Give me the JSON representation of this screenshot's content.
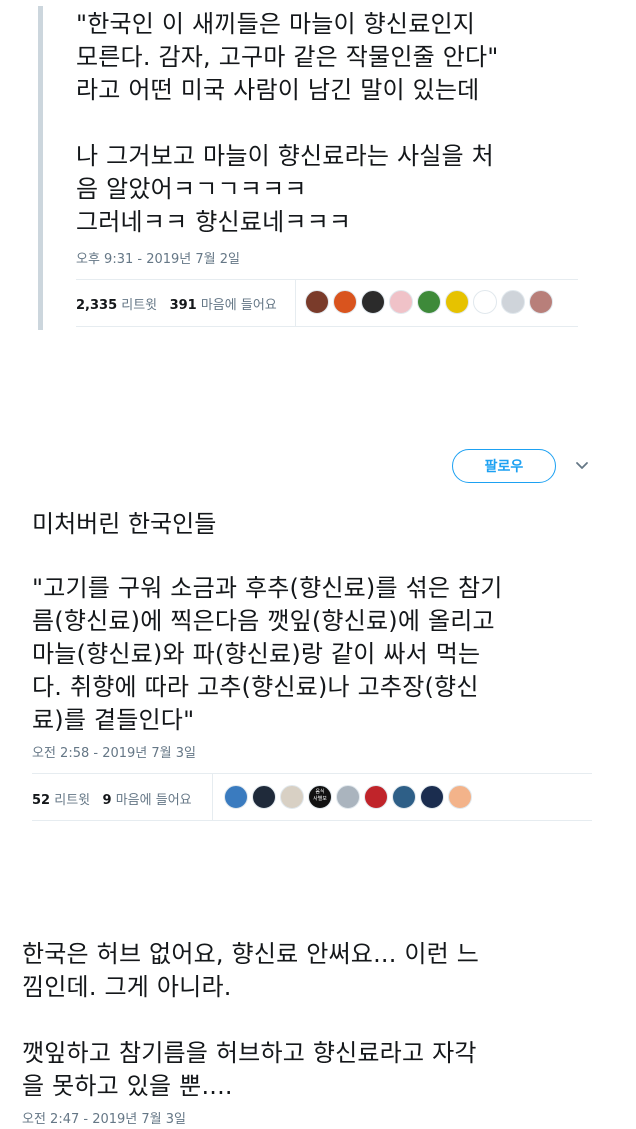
{
  "tweet1": {
    "text": "\"한국인 이 새끼들은 마늘이 향신료인지\n모른다. 감자, 고구마 같은 작물인줄 안다\"\n라고 어떤 미국 사람이 남긴 말이 있는데\n\n나 그거보고 마늘이 향신료라는 사실을 처\n음 알았어ㅋㄱㄱㅋㅋㅋ\n그러네ㅋㅋ 향신료네ㅋㅋㅋ",
    "timestamp": "오후 9:31 - 2019년 7월 2일",
    "retweets_count": "2,335",
    "retweets_label": "리트윗",
    "likes_count": "391",
    "likes_label": "마음에 들어요",
    "avatar_colors": [
      "#7a3b2a",
      "#d9541e",
      "#2b2b2b",
      "#f0c2c8",
      "#3e8a3a",
      "#e6c200",
      "#ffffff",
      "#cfd4da",
      "#b87f7a"
    ]
  },
  "tweet2": {
    "follow_label": "팔로우",
    "lead": "미처버린 한국인들",
    "text": "\"고기를 구워 소금과 후추(향신료)를 섞은 참기\n름(향신료)에 찍은다음 깻잎(향신료)에 올리고\n마늘(향신료)와 파(향신료)랑 같이 싸서 먹는\n다. 취향에 따라 고추(향신료)나 고추장(향신\n료)를 곁들인다\"",
    "timestamp": "오전 2:58 - 2019년 7월 3일",
    "retweets_count": "52",
    "retweets_label": "리트윗",
    "likes_count": "9",
    "likes_label": "마음에 들어요",
    "avatar_colors": [
      "#3a7bbf",
      "#1f2a3a",
      "#d8d0c4",
      "#111111",
      "#aab4be",
      "#c0242a",
      "#2e5f87",
      "#1b2d4f",
      "#f3b38a"
    ],
    "avatar4_text": "음식\n사별보"
  },
  "tweet3": {
    "text": "한국은 허브 없어요, 향신료 안써요... 이런 느\n낌인데. 그게 아니라.\n\n깻잎하고 참기름을 허브하고 향신료라고 자각\n을 못하고 있을 뿐....",
    "timestamp": "오전 2:47 - 2019년 7월 3일"
  },
  "accent_color": "#1da1f2",
  "icons": {
    "more": "chevron-down-icon"
  }
}
